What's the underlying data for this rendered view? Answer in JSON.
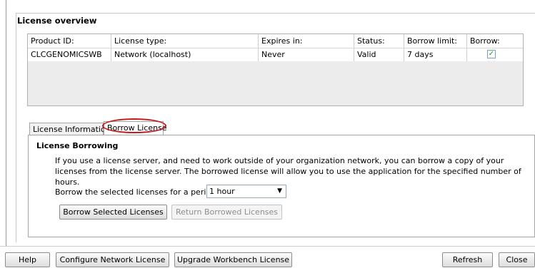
{
  "section_title": "License overview",
  "table": {
    "columns": [
      "Product ID:",
      "License type:",
      "Expires in:",
      "Status:",
      "Borrow limit:",
      "Borrow:"
    ],
    "rows": [
      {
        "product_id": "CLCGENOMICSWB",
        "license_type": "Network (localhost)",
        "expires_in": "Never",
        "status": "Valid",
        "borrow_limit": "7 days",
        "borrow_checked": true
      }
    ]
  },
  "tabs": {
    "license_information": "License Information",
    "borrow_license": "Borrow License"
  },
  "borrow_panel": {
    "title": "License Borrowing",
    "description": "If you use a license server, and need to work outside of your organization network, you can borrow a copy of your licenses from the license server. The borrowed license will allow you to use the application for the specified number of hours.",
    "period_label": "Borrow the selected licenses for a period of:",
    "period_value": "1 hour",
    "borrow_button": "Borrow Selected Licenses",
    "return_button": "Return Borrowed Licenses"
  },
  "footer": {
    "help": "Help",
    "configure": "Configure Network License",
    "upgrade": "Upgrade Workbench License",
    "refresh": "Refresh",
    "close": "Close"
  },
  "colors": {
    "highlight_ellipse": "#c0181b",
    "checkbox_check": "#21a121"
  }
}
